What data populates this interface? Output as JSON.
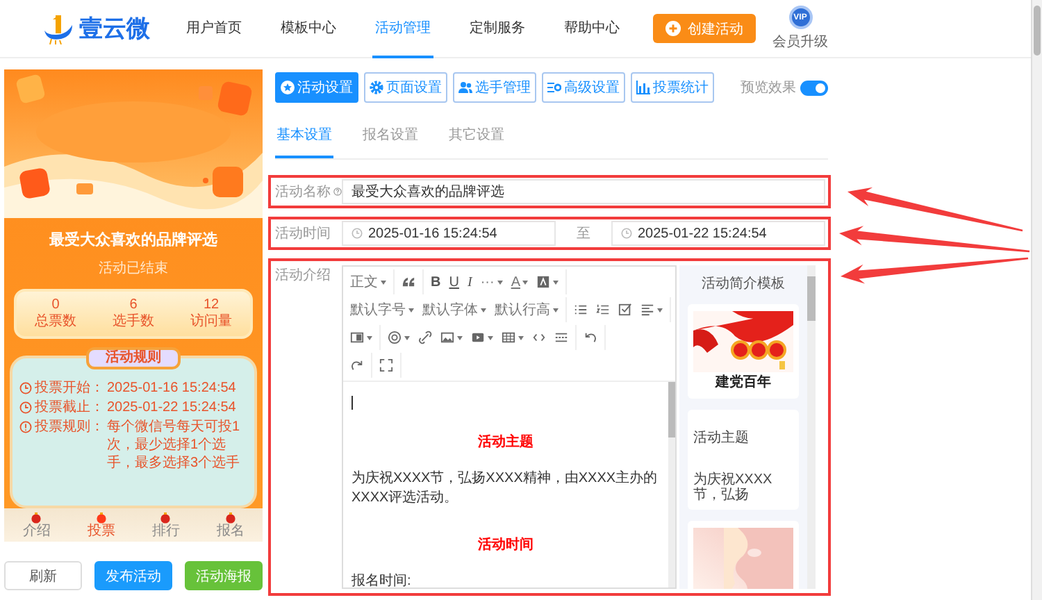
{
  "header": {
    "logo_text": "壹云微",
    "nav": [
      {
        "label": "用户首页",
        "selected": false
      },
      {
        "label": "模板中心",
        "selected": false
      },
      {
        "label": "活动管理",
        "selected": true
      },
      {
        "label": "定制服务",
        "selected": false
      },
      {
        "label": "帮助中心",
        "selected": false
      }
    ],
    "create_button": "创建活动",
    "vip_badge": "VIP",
    "member_label": "会员升级"
  },
  "preview": {
    "banner": {
      "kind": "picture"
    },
    "title": "最受大众喜欢的品牌评选",
    "status": "活动已结束",
    "stats": [
      {
        "value": "0",
        "label": "总票数"
      },
      {
        "value": "6",
        "label": "选手数"
      },
      {
        "value": "12",
        "label": "访问量"
      }
    ],
    "rules_title": "活动规则",
    "rules": [
      {
        "kind": "clock",
        "label": "投票开始：",
        "text": "2025-01-16 15:24:54"
      },
      {
        "kind": "clock",
        "label": "投票截止：",
        "text": "2025-01-22 15:24:54"
      },
      {
        "kind": "info",
        "label": "投票规则：",
        "text": "每个微信号每天可投1次，最少选择1个选手，最多选择3个选手"
      }
    ],
    "nav": [
      {
        "label": "介绍",
        "selected": false
      },
      {
        "label": "投票",
        "selected": true
      },
      {
        "label": "排行",
        "selected": false
      },
      {
        "label": "报名",
        "selected": false
      }
    ]
  },
  "actions": [
    {
      "kind": "default",
      "label": "刷新"
    },
    {
      "kind": "primary",
      "label": "发布活动"
    },
    {
      "kind": "success",
      "label": "活动海报"
    }
  ],
  "settings": {
    "tabs": [
      {
        "label": "活动设置",
        "selected": true
      },
      {
        "label": "页面设置",
        "selected": false
      },
      {
        "label": "选手管理",
        "selected": false
      },
      {
        "label": "高级设置",
        "selected": false
      },
      {
        "label": "投票统计",
        "selected": false
      }
    ],
    "preview_label": "预览效果",
    "preview_on": true,
    "subtabs": [
      {
        "label": "基本设置",
        "selected": true
      },
      {
        "label": "报名设置",
        "selected": false
      },
      {
        "label": "其它设置",
        "selected": false
      }
    ],
    "fields": [
      {
        "kind": "text",
        "label": "活动名称",
        "help": true,
        "value": "最受大众喜欢的品牌评选",
        "highlighted": true
      },
      {
        "kind": "daterange",
        "label": "活动时间",
        "help": false,
        "start": "2025-01-16 15:24:54",
        "separator": "至",
        "end": "2025-01-22 15:24:54",
        "highlighted": true
      },
      {
        "kind": "editor",
        "label": "活动介绍",
        "help": false,
        "highlighted": true
      }
    ]
  },
  "editor": {
    "toolbar": [
      [
        [
          {
            "kind": "text",
            "label": "正文",
            "caret": true
          }
        ],
        [
          {
            "kind": "icon",
            "caret": false
          }
        ],
        [
          {
            "kind": "bold",
            "label": "B",
            "caret": false
          },
          {
            "kind": "underline",
            "label": "U",
            "caret": false
          },
          {
            "kind": "italic",
            "label": "I",
            "caret": false
          },
          {
            "kind": "text",
            "label": "···",
            "caret": true
          },
          {
            "kind": "underline",
            "label": "A",
            "caret": true
          },
          {
            "kind": "icon",
            "caret": true
          }
        ]
      ],
      [
        [
          {
            "kind": "text",
            "label": "默认字号",
            "caret": true
          },
          {
            "kind": "text",
            "label": "默认字体",
            "caret": true
          },
          {
            "kind": "text",
            "label": "默认行高",
            "caret": true
          }
        ],
        [
          {
            "kind": "icon",
            "caret": false
          },
          {
            "kind": "icon",
            "caret": false
          },
          {
            "kind": "icon",
            "caret": false
          },
          {
            "kind": "icon",
            "caret": true
          }
        ]
      ],
      [
        [
          {
            "kind": "icon",
            "caret": true
          }
        ],
        [
          {
            "kind": "icon",
            "caret": true
          },
          {
            "kind": "icon",
            "caret": false
          },
          {
            "kind": "icon",
            "caret": true
          },
          {
            "kind": "icon",
            "caret": true
          },
          {
            "kind": "icon",
            "caret": true
          },
          {
            "kind": "icon",
            "caret": false
          },
          {
            "kind": "icon",
            "caret": false
          }
        ],
        [
          {
            "kind": "icon",
            "caret": false
          }
        ]
      ],
      [
        [
          {
            "kind": "icon",
            "caret": false
          }
        ],
        [
          {
            "kind": "icon",
            "caret": false
          }
        ]
      ]
    ],
    "content": [
      {
        "kind": "cursor"
      },
      {
        "kind": "heading",
        "text": "活动主题"
      },
      {
        "kind": "paragraph",
        "text": "为庆祝XXXX节，弘扬XXXX精神，由XXXX主办的XXXX评选活动。"
      },
      {
        "kind": "heading",
        "text": "活动时间"
      },
      {
        "kind": "paragraph",
        "text": "报名时间:"
      }
    ],
    "templates": {
      "title": "活动简介模板",
      "cards": [
        {
          "kind": "picture",
          "caption": "建党百年"
        },
        {
          "kind": "text",
          "title": "活动主题",
          "text": "为庆祝XXXX节，弘扬"
        },
        {
          "kind": "picture"
        }
      ]
    }
  }
}
